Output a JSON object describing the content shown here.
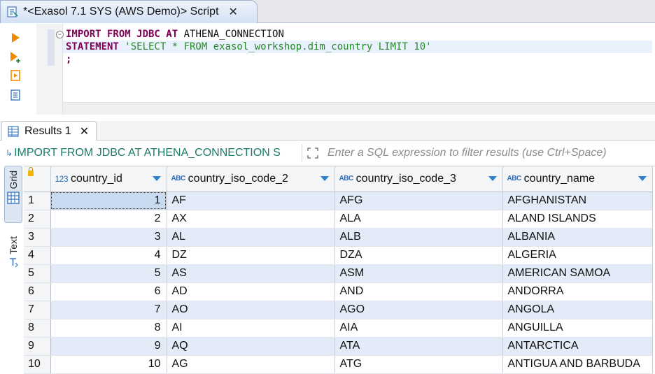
{
  "editor_tab": {
    "title": "*<Exasol 7.1 SYS (AWS Demo)> Script",
    "close": "✕"
  },
  "code": {
    "line1": {
      "kw": "IMPORT FROM JDBC AT",
      "id": " ATHENA_CONNECTION"
    },
    "line2": {
      "kw": "STATEMENT",
      "str": " 'SELECT * FROM exasol_workshop.dim_country LIMIT 10'"
    },
    "line3": {
      "kw": ";"
    }
  },
  "results_tab": {
    "label": "Results 1",
    "close": "✕"
  },
  "filter": {
    "query": "IMPORT FROM JDBC AT ATHENA_CONNECTION S",
    "placeholder": "Enter a SQL expression to filter results (use Ctrl+Space)"
  },
  "views": {
    "grid": "Grid",
    "text": "Text"
  },
  "table": {
    "columns": [
      {
        "type": "123",
        "name": "country_id"
      },
      {
        "type": "ABC",
        "name": "country_iso_code_2"
      },
      {
        "type": "ABC",
        "name": "country_iso_code_3"
      },
      {
        "type": "ABC",
        "name": "country_name"
      }
    ],
    "rows": [
      {
        "n": "1",
        "id": "1",
        "c2": "AF",
        "c3": "AFG",
        "name": "AFGHANISTAN"
      },
      {
        "n": "2",
        "id": "2",
        "c2": "AX",
        "c3": "ALA",
        "name": "ALAND ISLANDS"
      },
      {
        "n": "3",
        "id": "3",
        "c2": "AL",
        "c3": "ALB",
        "name": "ALBANIA"
      },
      {
        "n": "4",
        "id": "4",
        "c2": "DZ",
        "c3": "DZA",
        "name": "ALGERIA"
      },
      {
        "n": "5",
        "id": "5",
        "c2": "AS",
        "c3": "ASM",
        "name": "AMERICAN SAMOA"
      },
      {
        "n": "6",
        "id": "6",
        "c2": "AD",
        "c3": "AND",
        "name": "ANDORRA"
      },
      {
        "n": "7",
        "id": "7",
        "c2": "AO",
        "c3": "AGO",
        "name": "ANGOLA"
      },
      {
        "n": "8",
        "id": "8",
        "c2": "AI",
        "c3": "AIA",
        "name": "ANGUILLA"
      },
      {
        "n": "9",
        "id": "9",
        "c2": "AQ",
        "c3": "ATA",
        "name": "ANTARCTICA"
      },
      {
        "n": "10",
        "id": "10",
        "c2": "AG",
        "c3": "ATG",
        "name": "ANTIGUA AND BARBUDA"
      }
    ]
  },
  "colors": {
    "keyword": "#7f0055",
    "string": "#2a8a2a",
    "row_alt": "#e2ebf7",
    "accent": "#2f7fd1"
  }
}
